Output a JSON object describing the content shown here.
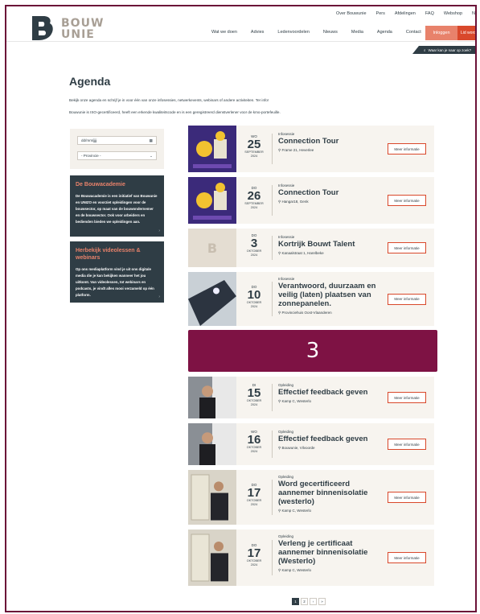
{
  "header": {
    "logo_text_1": "BOUW",
    "logo_text_2": "UNIE",
    "topnav": [
      "Over Bouwunie",
      "Pers",
      "Afdelingen",
      "FAQ",
      "Webshop",
      "N"
    ],
    "mainnav": [
      "Wat we doen",
      "Advies",
      "Ledenvoordelen",
      "Nieuws",
      "Media",
      "Agenda",
      "Contact"
    ],
    "login_label": "Inloggen",
    "member_label": "Lid worden",
    "ribbon_label": "Waar kan je naar op zoek?"
  },
  "page": {
    "title": "Agenda",
    "intro_1": "Bekijk onze agenda en schrijf je in voor één van onze infosessies, netwerkevents, webinars of andere activiteiten. Ter info!",
    "intro_2": "Bouwunie is ISO-gecertificeerd, heeft een erkende kwaliteitscode en is een geregistreerd dienstverlener voor de kmo-portefeuille."
  },
  "filters": {
    "date_value": "dd/mm/jjjj",
    "province_value": "- Provincie -"
  },
  "sidebar": {
    "box1": {
      "title": "De Bouwacademie",
      "text": "De Bouwacademie is een initiatief van Bouwunie en UNIZO en voorziet opleidingen voor de bouwsector, op maat van de bouwondernemer en de bouwsector. Ook voor arbeiders en bedienden bieden we opleidingen aan."
    },
    "box2": {
      "title": "Herbekijk videolessen & webinars",
      "text": "Op ons mediaplatform vind je uit ons digitale media die je kan bekijken wanneer het jou uitkomt. Van videolessen, tot webinars en podcasts, je vindt alles mooi verzameld op één platform."
    }
  },
  "events": [
    {
      "dow": "WO",
      "day": "25",
      "month": "SEPTEMBER",
      "year": "2024",
      "category": "Infosessie",
      "title": "Connection Tour",
      "location": "Frame 21, Heverlee",
      "button": "Meer informatie"
    },
    {
      "dow": "DO",
      "day": "26",
      "month": "SEPTEMBER",
      "year": "2024",
      "category": "Infosessie",
      "title": "Connection Tour",
      "location": "Hangar18, Genk",
      "button": "Meer informatie"
    },
    {
      "dow": "DO",
      "day": "3",
      "month": "OKTOBER",
      "year": "2024",
      "category": "Infosessie",
      "title": "Kortrijk Bouwt Talent",
      "location": "Kanaalstraat 1, Harelbeke",
      "button": "Meer informatie"
    },
    {
      "dow": "DO",
      "day": "10",
      "month": "OKTOBER",
      "year": "2024",
      "category": "Infosessie",
      "title": "Verantwoord, duurzaam en veilig (laten) plaatsen van zonnepanelen.",
      "location": "Provinciehuis Oost-Vlaanderen",
      "button": "Meer informatie"
    },
    {
      "dow": "DI",
      "day": "15",
      "month": "OKTOBER",
      "year": "2024",
      "category": "Opleiding",
      "title": "Effectief feedback geven",
      "location": "Kamp C, Westerlo",
      "button": "Meer informatie"
    },
    {
      "dow": "WO",
      "day": "16",
      "month": "OKTOBER",
      "year": "2024",
      "category": "Opleiding",
      "title": "Effectief feedback geven",
      "location": "Bouwunie, Vilvoorde",
      "button": "Meer informatie"
    },
    {
      "dow": "DO",
      "day": "17",
      "month": "OKTOBER",
      "year": "2024",
      "category": "Opleiding",
      "title": "Word gecertificeerd aannemer binnenisolatie (westerlo)",
      "location": "Kamp C, Westerlo",
      "button": "Meer informatie"
    },
    {
      "dow": "DO",
      "day": "17",
      "month": "OKTOBER",
      "year": "2024",
      "category": "Opleiding",
      "title": "Verleng je certificaat aannemer binnenisolatie (Westerlo)",
      "location": "Kamp C, Westerlo",
      "button": "Meer informatie"
    }
  ],
  "banner": {
    "label": "3"
  },
  "pagination": [
    "1",
    "2",
    "›",
    "»"
  ],
  "colors": {
    "accent": "#d9482b",
    "dark": "#2f3d45",
    "banner": "#7e1244",
    "card_bg": "#f7f4ef"
  }
}
